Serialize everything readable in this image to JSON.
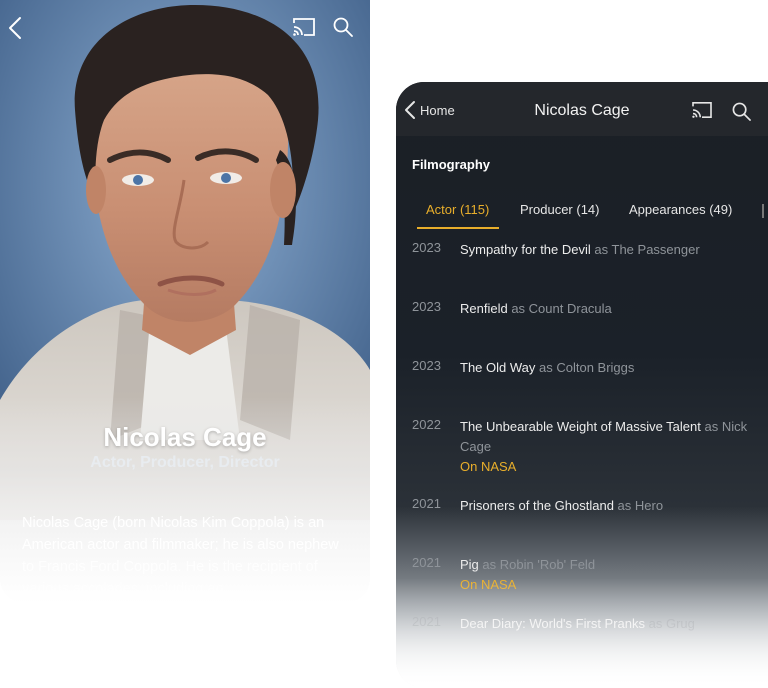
{
  "profile": {
    "name": "Nicolas Cage",
    "roles": "Actor, Producer, Director",
    "bio": "Nicolas Cage (born Nicolas Kim Coppola) is an American actor and filmmaker; he is also nephew to Francis Ford Coppola. He is the recipient of various accolades, including an"
  },
  "header": {
    "back_label": "Home",
    "title": "Nicolas Cage"
  },
  "filmography": {
    "label": "Filmography",
    "tabs": [
      {
        "label": "Actor (115)",
        "active": true
      },
      {
        "label": "Producer (14)",
        "active": false
      },
      {
        "label": "Appearances (49)",
        "active": false
      }
    ],
    "items": [
      {
        "year": "2023",
        "title": "Sympathy for the Devil",
        "as": "as The Passenger",
        "note": ""
      },
      {
        "year": "2023",
        "title": "Renfield",
        "as": "as Count Dracula",
        "note": ""
      },
      {
        "year": "2023",
        "title": "The Old Way",
        "as": "as Colton Briggs",
        "note": ""
      },
      {
        "year": "2022",
        "title": "The Unbearable Weight of Massive Talent",
        "as": "as Nick Cage",
        "note": "On NASA"
      },
      {
        "year": "2021",
        "title": "Prisoners of the Ghostland",
        "as": "as Hero",
        "note": ""
      },
      {
        "year": "2021",
        "title": "Pig",
        "as": "as Robin 'Rob' Feld",
        "note": "On NASA"
      },
      {
        "year": "2021",
        "title": "Dear Diary: World's First Pranks",
        "as": "as Grug",
        "note": ""
      }
    ]
  },
  "colors": {
    "accent": "#e8ae2b",
    "header_bg": "#24272c",
    "list_bg": "#1b2129"
  },
  "icons": {
    "back": "chevron-left-icon",
    "cast": "cast-icon",
    "search": "search-icon"
  }
}
